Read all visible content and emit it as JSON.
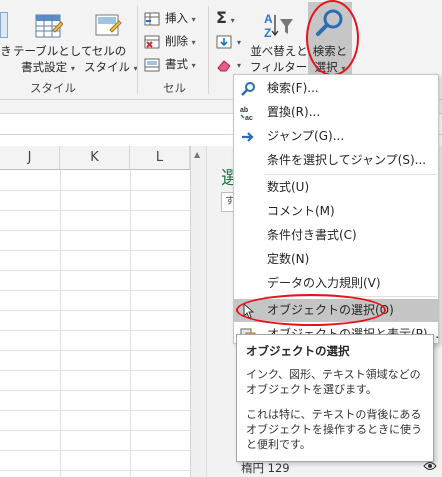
{
  "ribbon": {
    "partial_label": "き",
    "format_as_table": {
      "line1": "テーブルとして",
      "line2": "書式設定"
    },
    "cell_styles": {
      "line1": "セルの",
      "line2": "スタイル"
    },
    "group_styles": "スタイル",
    "cells": {
      "insert": "挿入",
      "delete": "削除",
      "format": "書式"
    },
    "group_cells": "セル",
    "sort_filter": {
      "line1": "並べ替えと",
      "line2": "フィルター"
    },
    "find_select": {
      "line1": "検索と",
      "line2": "選択"
    }
  },
  "sheet": {
    "columns": [
      "J",
      "K",
      "L"
    ]
  },
  "pane": {
    "title_partial": "選",
    "input_partial": "す",
    "footer": "楕円 129"
  },
  "menu": {
    "items": [
      {
        "label": "検索(F)...",
        "icon": "search-icon"
      },
      {
        "label": "置換(R)...",
        "icon": "replace-icon"
      },
      {
        "label": "ジャンプ(G)...",
        "icon": "arrow-right-icon"
      },
      {
        "label": "条件を選択してジャンプ(S)...",
        "icon": ""
      },
      {
        "label": "数式(U)",
        "icon": ""
      },
      {
        "label": "コメント(M)",
        "icon": ""
      },
      {
        "label": "条件付き書式(C)",
        "icon": ""
      },
      {
        "label": "定数(N)",
        "icon": ""
      },
      {
        "label": "データの入力規則(V)",
        "icon": ""
      },
      {
        "label": "オブジェクトの選択(O)",
        "icon": "cursor-icon",
        "highlighted": true
      },
      {
        "label": "オブジェクトの選択と表示(P)...",
        "icon": "selection-pane-icon"
      }
    ]
  },
  "tooltip": {
    "title": "オブジェクトの選択",
    "body1": "インク、図形、テキスト領域などのオブジェクトを選びます。",
    "body2": "これは特に、テキストの背後にあるオブジェクトを操作するときに使うと便利です。"
  },
  "colors": {
    "highlight_ring": "#e8121b",
    "accent_blue": "#2b78d4",
    "pane_green": "#217346"
  }
}
